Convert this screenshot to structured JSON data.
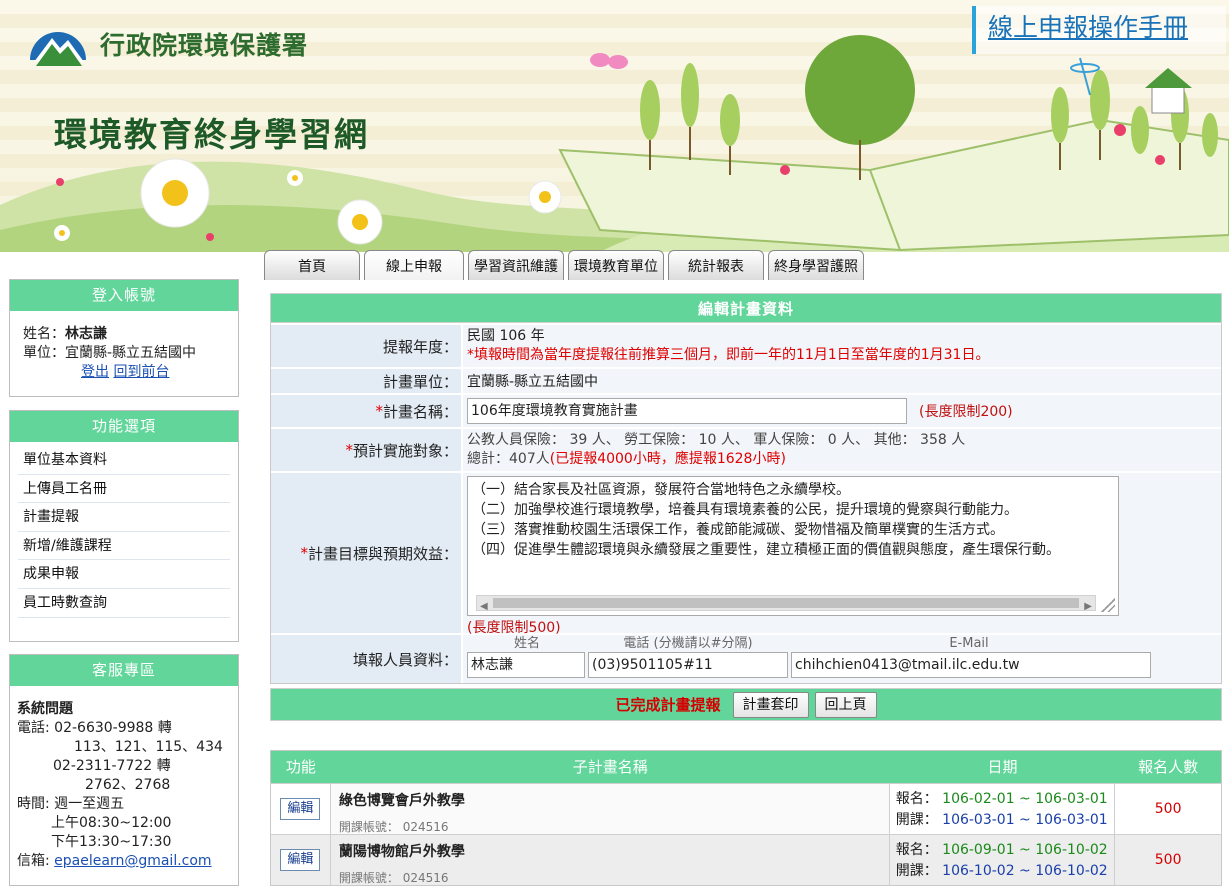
{
  "header": {
    "org_name": "行政院環境保護署",
    "site_title": "環境教育終身學習網",
    "manual_link": "線上申報操作手冊"
  },
  "tabs": [
    {
      "label": "首頁"
    },
    {
      "label": "線上申報",
      "active": true
    },
    {
      "label": "學習資訊維護"
    },
    {
      "label": "環境教育單位"
    },
    {
      "label": "統計報表"
    },
    {
      "label": "終身學習護照"
    }
  ],
  "login": {
    "title": "登入帳號",
    "name_label": "姓名：",
    "name": "林志謙",
    "unit_label": "單位：",
    "unit": "宜蘭縣-縣立五結國中",
    "logout": "登出",
    "back_to_front": "回到前台"
  },
  "menu": {
    "title": "功能選項",
    "items": [
      "單位基本資料",
      "上傳員工名冊",
      "計畫提報",
      "新增/維護課程",
      "成果申報",
      "員工時數查詢"
    ]
  },
  "service": {
    "title": "客服專區",
    "system_issue": "系統問題",
    "phone_line1": "電話: 02-6630-9988 轉",
    "phone_line2": "113、121、115、434",
    "phone_line3": "02-2311-7722 轉",
    "phone_line4": "2762、2768",
    "time_line1": "時間: 週一至週五",
    "time_line2": "上午08:30~12:00",
    "time_line3": "下午13:30~17:30",
    "email_label": "信箱: ",
    "email": "epaelearn@gmail.com"
  },
  "form": {
    "title": "編輯計畫資料",
    "year_label": "提報年度：",
    "year_value": "民國 106 年",
    "year_note": "*填報時間為當年度提報往前推算三個月，即前一年的11月1日至當年度的1月31日。",
    "unit_label": "計畫單位：",
    "unit_value": "宜蘭縣-縣立五結國中",
    "plan_name_label": "計畫名稱：",
    "plan_name_value": "106年度環境教育實施計畫",
    "plan_name_limit": "(長度限制200)",
    "target_label": "預計實施對象：",
    "target_line1": "公教人員保險： 39 人、 勞工保險： 10 人、 軍人保險： 0 人、 其他： 358 人",
    "target_total": "總計：407人",
    "target_note": "(已提報4000小時，應提報1628小時)",
    "goal_label": "計畫目標與預期效益：",
    "goal_lines": [
      "（一）結合家長及社區資源，發展符合當地特色之永續學校。",
      "（二）加強學校進行環境教學，培養具有環境素養的公民，提升環境的覺察與行動能力。",
      "（三）落實推動校園生活環保工作，養成節能減碳、愛物惜福及簡單樸實的生活方式。",
      "（四）促進學生體認環境與永續發展之重要性，建立積極正面的價值觀與態度，產生環保行動。"
    ],
    "goal_limit": "(長度限制500)",
    "reporter_label": "填報人員資料：",
    "reporter_name_head": "姓名",
    "reporter_phone_head": "電話 (分機請以#分隔)",
    "reporter_email_head": "E-Mail",
    "reporter_name": "林志謙",
    "reporter_phone": "(03)9501105#11",
    "reporter_email": "chihchien0413@tmail.ilc.edu.tw",
    "done_text": "已完成計畫提報",
    "print_button": "計畫套印",
    "back_button": "回上頁"
  },
  "subplans": {
    "headers": {
      "func": "功能",
      "name": "子計畫名稱",
      "date": "日期",
      "count": "報名人數"
    },
    "edit_label": "編輯",
    "signup_label": "報名：",
    "class_label": "開課：",
    "account_label": "開課帳號：",
    "rows": [
      {
        "name": "綠色博覽會戶外教學",
        "account": "024516",
        "signup": "106-02-01 ~ 106-03-01",
        "class": "106-03-01 ~ 106-03-01",
        "count": "500"
      },
      {
        "name": "蘭陽博物館戶外教學",
        "account": "024516",
        "signup": "106-09-01 ~ 106-10-02",
        "class": "106-10-02 ~ 106-10-02",
        "count": "500"
      }
    ]
  }
}
